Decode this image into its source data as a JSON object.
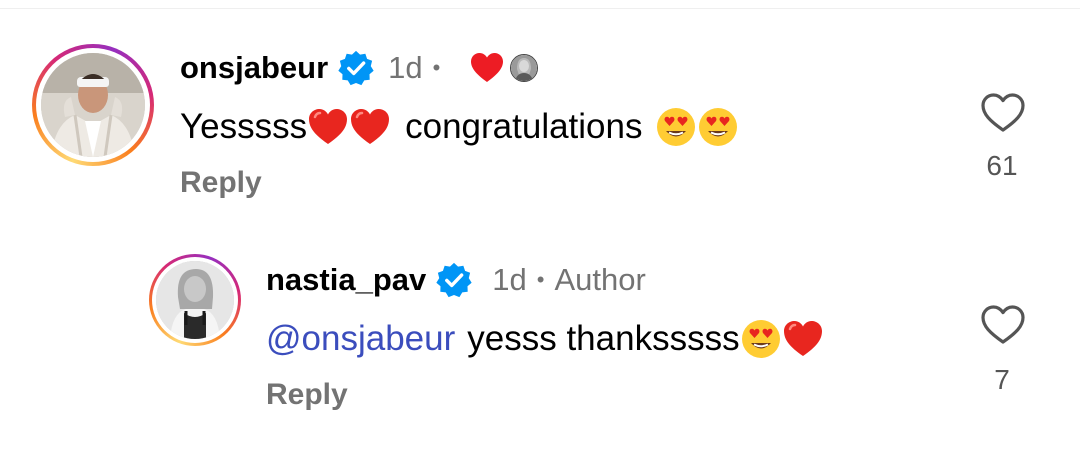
{
  "comments": [
    {
      "username": "onsjabeur",
      "verified": true,
      "timestamp": "1d",
      "liked_by_creator": true,
      "text_before": "Yesssss",
      "text_middle": "congratulations",
      "emojis": [
        "red-heart",
        "red-heart",
        "heart-eyes",
        "heart-eyes"
      ],
      "reply_label": "Reply",
      "like_count": "61"
    },
    {
      "username": "nastia_pav",
      "verified": true,
      "timestamp": "1d",
      "author_label": "Author",
      "mention": "@onsjabeur",
      "text": "yesss thanksssss",
      "emojis": [
        "heart-eyes",
        "red-heart"
      ],
      "reply_label": "Reply",
      "like_count": "7"
    }
  ],
  "colors": {
    "secondary_text": "#737373",
    "verified_blue": "#0095f6",
    "mention_blue": "#3b4dbd",
    "heart_red": "#ed1c24"
  }
}
